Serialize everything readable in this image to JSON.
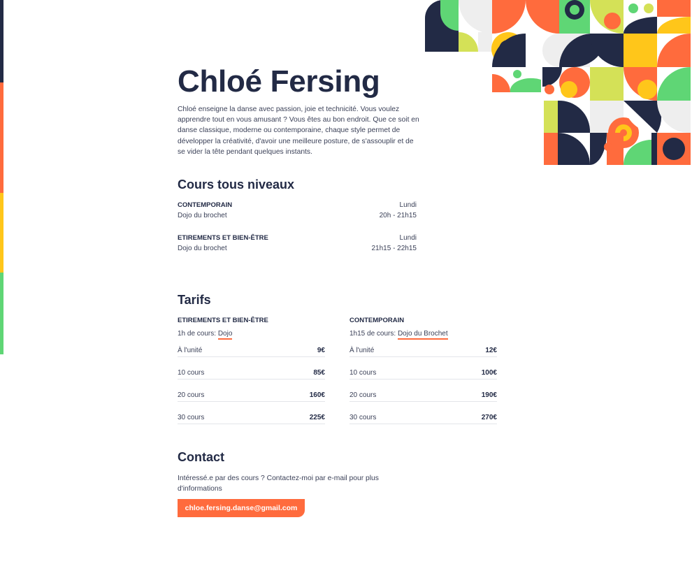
{
  "colors": {
    "navy": "#222a45",
    "orange": "#ff6b3d",
    "yellow": "#ffc61a",
    "green": "#5fd675",
    "lime": "#d4e157",
    "light": "#eeeeee"
  },
  "header": {
    "title": "Chloé Fersing",
    "intro": "Chloé enseigne la danse avec passion, joie et technicité. Vous voulez apprendre tout en vous amusant ? Vous êtes au bon endroit. Que ce soit en danse classique, moderne ou contemporaine, chaque style permet de développer la créativité, d'avoir une meilleure posture, de s'assouplir et de se vider la tête pendant quelques instants."
  },
  "courses": {
    "heading": "Cours tous niveaux",
    "items": [
      {
        "name": "CONTEMPORAIN",
        "place": "Dojo du brochet",
        "day": "Lundi",
        "time": "20h - 21h15"
      },
      {
        "name": "ETIREMENTS ET BIEN-ÊTRE",
        "place": "Dojo du brochet",
        "day": "Lundi",
        "time": "21h15 - 22h15"
      }
    ]
  },
  "tarifs": {
    "heading": "Tarifs",
    "items": [
      {
        "name": "ETIREMENTS ET BIEN-ÊTRE",
        "sub_prefix": "1h de cours: ",
        "sub_place": "Dojo",
        "rows": [
          {
            "label": "À l'unité",
            "price": "9€"
          },
          {
            "label": "10 cours",
            "price": "85€"
          },
          {
            "label": "20 cours",
            "price": "160€"
          },
          {
            "label": "30 cours",
            "price": "225€"
          }
        ]
      },
      {
        "name": "CONTEMPORAIN",
        "sub_prefix": "1h15 de cours: ",
        "sub_place": "Dojo du Brochet",
        "rows": [
          {
            "label": "À l'unité",
            "price": "12€"
          },
          {
            "label": "10 cours",
            "price": "100€"
          },
          {
            "label": "20 cours",
            "price": "190€"
          },
          {
            "label": "30 cours",
            "price": "270€"
          }
        ]
      }
    ]
  },
  "contact": {
    "heading": "Contact",
    "text": "Intéressé.e par des cours ? Contactez-moi par e-mail pour plus d'informations",
    "email": "chloe.fersing.danse@gmail.com"
  }
}
